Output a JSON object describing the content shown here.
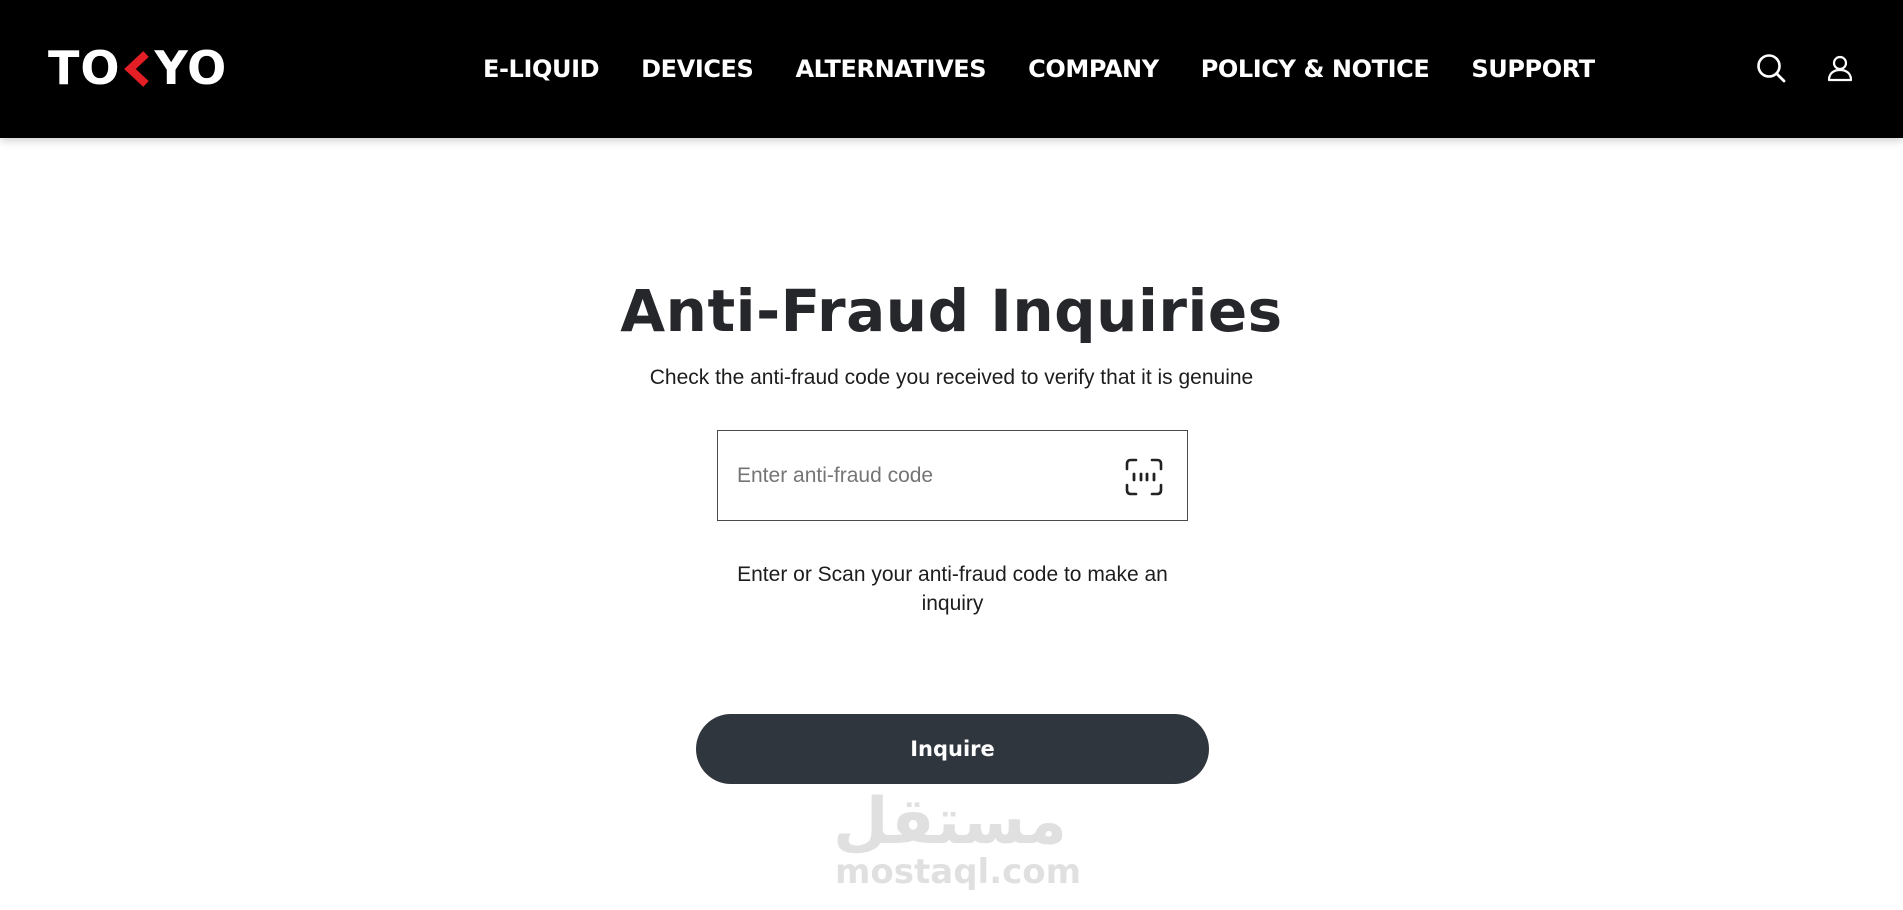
{
  "header": {
    "logo": {
      "left": "TO",
      "right": "YO",
      "accent_color": "#e31e24"
    },
    "nav": [
      {
        "label": "E-LIQUID"
      },
      {
        "label": "DEVICES"
      },
      {
        "label": "ALTERNATIVES"
      },
      {
        "label": "COMPANY"
      },
      {
        "label": "POLICY & NOTICE"
      },
      {
        "label": "SUPPORT"
      }
    ],
    "icons": {
      "search": "search-icon",
      "account": "user-icon"
    },
    "background_color": "#000000"
  },
  "main": {
    "title": "Anti-Fraud Inquiries",
    "subtitle": "Check the anti-fraud code you received to verify that it is genuine",
    "code_input": {
      "placeholder": "Enter anti-fraud code",
      "value": ""
    },
    "scan_icon": "scan-icon",
    "helper_text": "Enter or Scan your anti-fraud code to make an inquiry",
    "inquire_button": {
      "label": "Inquire",
      "color": "#30363d"
    }
  },
  "watermark": {
    "arabic": "مستقل",
    "latin": "mostaql.com"
  }
}
